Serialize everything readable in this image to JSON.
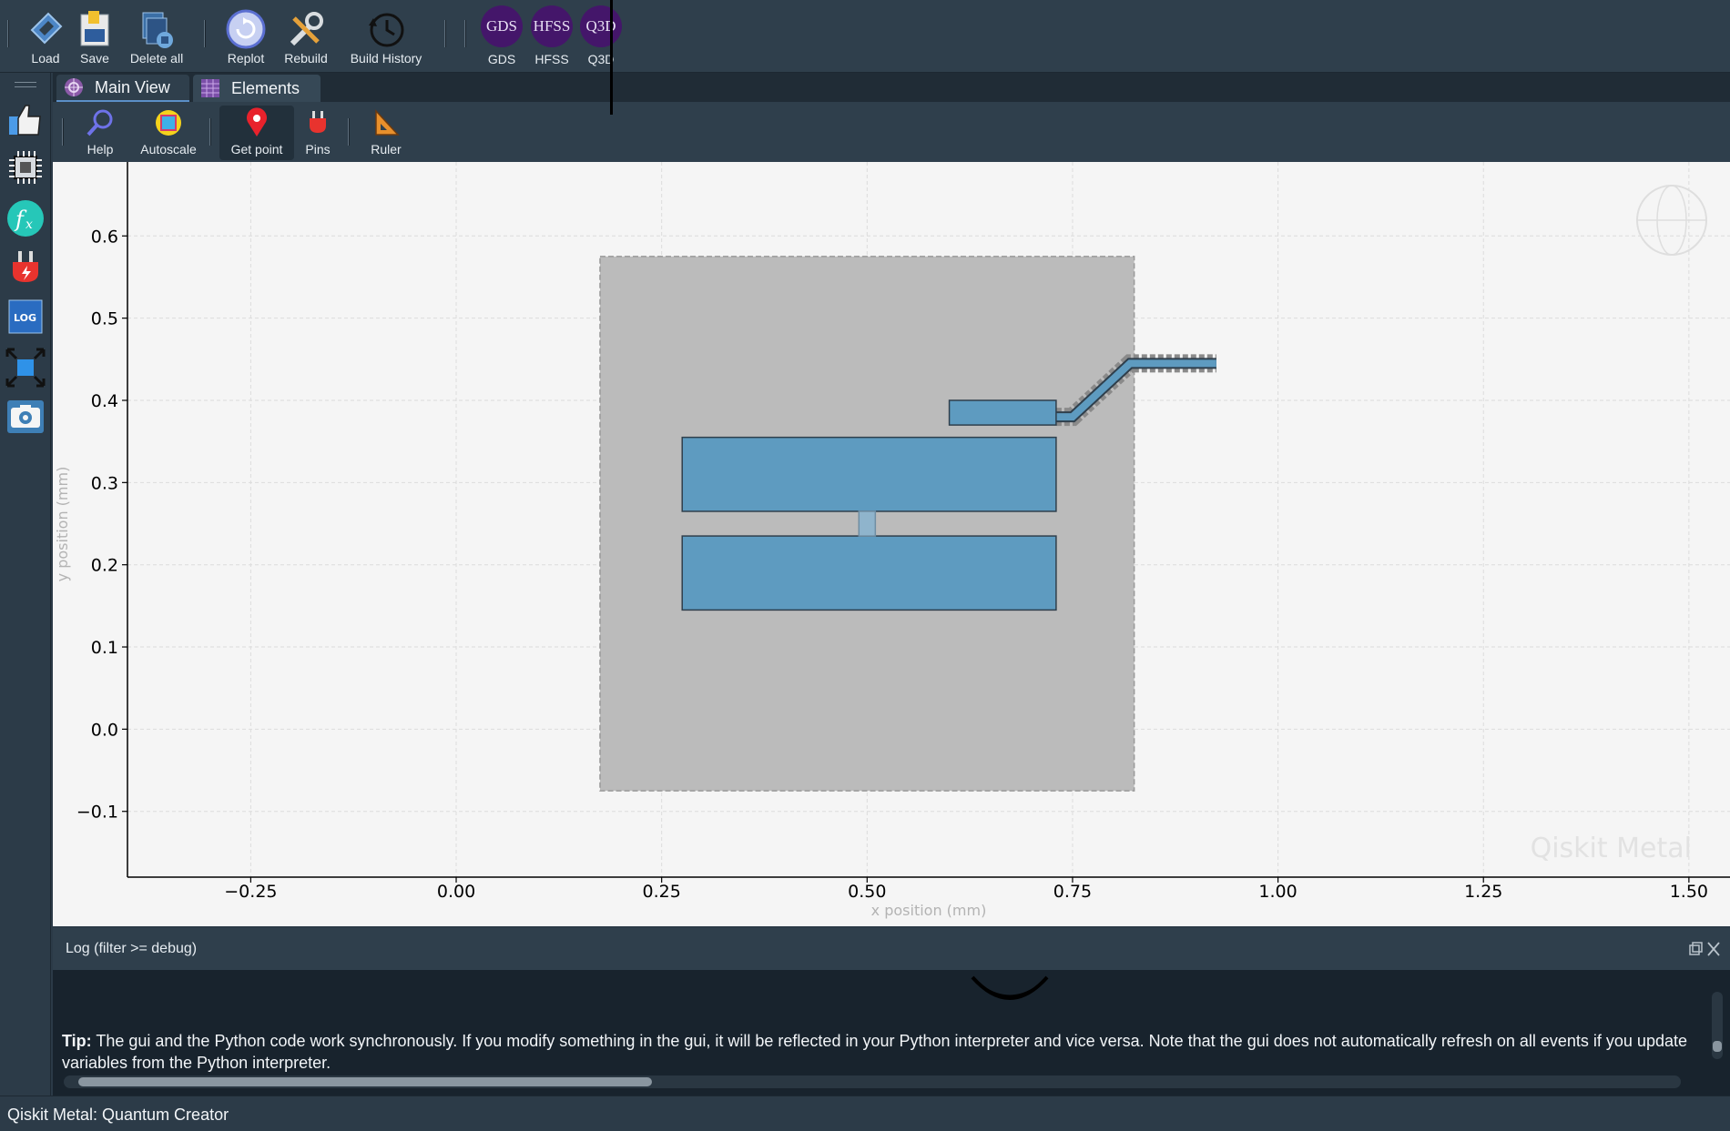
{
  "toolbar": {
    "load": "Load",
    "save": "Save",
    "delete_all": "Delete all",
    "replot": "Replot",
    "rebuild": "Rebuild",
    "build_history": "Build History",
    "gds_icon": "GDS",
    "gds": "GDS",
    "hfss_icon": "HFSS",
    "hfss": "HFSS",
    "q3d_icon": "Q3D",
    "q3d": "Q3D"
  },
  "sidebar": {
    "icons": [
      "thumbs-up-icon",
      "chip-icon",
      "function-icon",
      "plug-icon",
      "log-icon",
      "fullscreen-icon",
      "camera-icon"
    ],
    "log_icon_text": "LOG"
  },
  "tabs": [
    {
      "label": "Main View"
    },
    {
      "label": "Elements"
    }
  ],
  "plot_toolbar": {
    "help": "Help",
    "autoscale": "Autoscale",
    "get_point": "Get point",
    "pins": "Pins",
    "ruler": "Ruler"
  },
  "plot": {
    "xlabel": "x position (mm)",
    "ylabel": "y position (mm)",
    "watermark": "Qiskit Metal",
    "xlim": [
      -0.4,
      1.55
    ],
    "ylim": [
      -0.18,
      0.69
    ],
    "xticks": [
      {
        "value": -0.25,
        "label": "−0.25"
      },
      {
        "value": 0.0,
        "label": "0.00"
      },
      {
        "value": 0.25,
        "label": "0.25"
      },
      {
        "value": 0.5,
        "label": "0.50"
      },
      {
        "value": 0.75,
        "label": "0.75"
      },
      {
        "value": 1.0,
        "label": "1.00"
      },
      {
        "value": 1.25,
        "label": "1.25"
      },
      {
        "value": 1.5,
        "label": "1.50"
      }
    ],
    "yticks": [
      {
        "value": -0.1,
        "label": "−0.1"
      },
      {
        "value": 0.0,
        "label": "0.0"
      },
      {
        "value": 0.1,
        "label": "0.1"
      },
      {
        "value": 0.2,
        "label": "0.2"
      },
      {
        "value": 0.3,
        "label": "0.3"
      },
      {
        "value": 0.4,
        "label": "0.4"
      },
      {
        "value": 0.5,
        "label": "0.5"
      },
      {
        "value": 0.6,
        "label": "0.6"
      }
    ],
    "colors": {
      "background": "#f5f5f5",
      "ground_cutout": "#bbbbbb",
      "metal": "#5e9bc0",
      "metal_edge": "#2f3f4c"
    },
    "shapes": {
      "cutout": [
        0.175,
        -0.075,
        0.825,
        0.575
      ],
      "pad_top": [
        0.275,
        0.265,
        0.73,
        0.355
      ],
      "pad_bottom": [
        0.275,
        0.145,
        0.73,
        0.235
      ],
      "junction": [
        0.49,
        0.235,
        0.51,
        0.265
      ],
      "connector_pad": [
        0.6,
        0.37,
        0.73,
        0.4
      ],
      "lead": [
        [
          0.73,
          0.38
        ],
        [
          0.75,
          0.38
        ],
        [
          0.82,
          0.445
        ],
        [
          0.925,
          0.445
        ]
      ]
    }
  },
  "log": {
    "title": "Log  (filter >= debug)",
    "tip_label": "Tip:",
    "tip_text": " The gui and the Python code work synchronously. If you modify something in the gui, it will be reflected in your Python interpreter and vice versa. Note that the gui does not automatically refresh on all events if you update variables from the Python interpreter."
  },
  "status": {
    "text": "Qiskit Metal: Quantum Creator"
  }
}
